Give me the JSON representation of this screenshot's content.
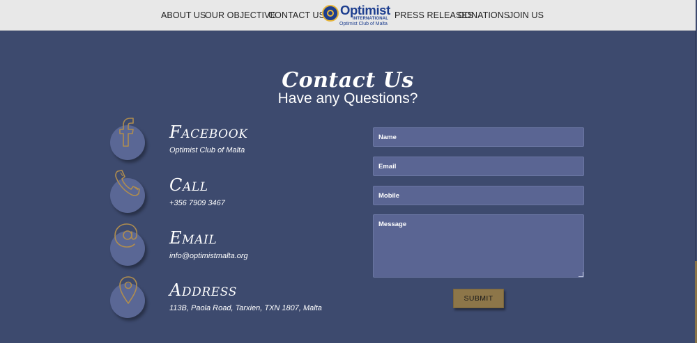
{
  "nav": {
    "items_left": [
      "ABOUT US",
      "OUR OBJECTIVE",
      "CONTACT US"
    ],
    "items_right": [
      "PRESS RELEASES",
      "DONATIONS",
      "JOIN US"
    ],
    "logo": {
      "wordmark": "Optimist",
      "subtext": "INTERNATIONAL",
      "club": "Optimist Club of Malta",
      "icon": "optimist-emblem-icon"
    }
  },
  "header": {
    "title": "Contact Us",
    "subtitle": "Have any Questions?"
  },
  "contacts": [
    {
      "icon": "facebook-icon",
      "heading": "Facebook",
      "detail": "Optimist Club of Malta"
    },
    {
      "icon": "phone-icon",
      "heading": "Call",
      "detail": "+356 7909 3467"
    },
    {
      "icon": "at-sign-icon",
      "heading": "Email",
      "detail": "info@optimistmalta.org"
    },
    {
      "icon": "location-pin-icon",
      "heading": "Address",
      "detail": "113B, Paola Road, Tarxien, TXN 1807, Malta"
    }
  ],
  "form": {
    "name_placeholder": "Name",
    "email_placeholder": "Email",
    "mobile_placeholder": "Mobile",
    "message_placeholder": "Message",
    "submit_label": "SUBMIT"
  },
  "colors": {
    "background": "#3d4a6e",
    "field": "#5a6593",
    "accent_gold": "#8d7649",
    "nav_bg": "#e8e8e8",
    "brand_blue": "#1d3e8f"
  }
}
